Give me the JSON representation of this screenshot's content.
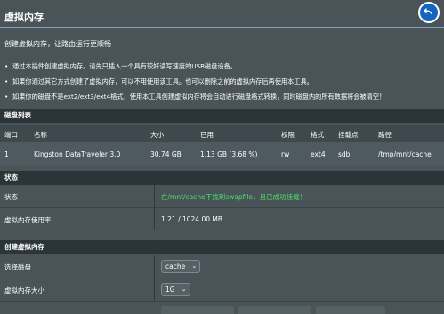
{
  "header": {
    "title": "虚拟内存"
  },
  "intro": {
    "subtitle": "创建虚拟内存，让路由运行更顺畅",
    "bullets": [
      "通过本插件创建虚拟内存。请先只插入一个具有较好读写速度的USB磁盘设备。",
      "如果你通过其它方式创建了虚拟内存，可以不用使用该工具。也可以删除之前的虚拟内存后再使用本工具。",
      "如果你的磁盘不是ext2/ext3/ext4格式，使用本工具创建虚拟内存将会自动进行磁盘格式转换，同时磁盘内的所有数据将会被清空！"
    ]
  },
  "disk_list": {
    "heading": "磁盘列表",
    "columns": [
      "端口",
      "名称",
      "大小",
      "已用",
      "权限",
      "格式",
      "挂载点",
      "路径"
    ],
    "rows": [
      [
        "1",
        "Kingston DataTraveler 3.0",
        "30.74 GB",
        "1.13 GB (3.68 %)",
        "rw",
        "ext4",
        "sdb",
        "/tmp/mnt/cache"
      ]
    ]
  },
  "status": {
    "heading": "状态",
    "state_label": "状态",
    "state_value": "在/mnt/cache下找到swapfile，且已成功挂载！",
    "usage_label": "虚拟内存使用率",
    "usage_value": "1.21 / 1024.00 MB"
  },
  "create": {
    "heading": "创建虚拟内存",
    "disk_label": "选择磁盘",
    "disk_value": "cache",
    "size_label": "虚拟内存大小",
    "size_value": "1G"
  },
  "colors": {
    "background": "#4a5357",
    "section": "#2b3437",
    "success": "#46e36a",
    "accent": "#1565c0"
  },
  "icons": {
    "back": "back-arrow-icon",
    "dropdown": "chevron-down-icon"
  }
}
